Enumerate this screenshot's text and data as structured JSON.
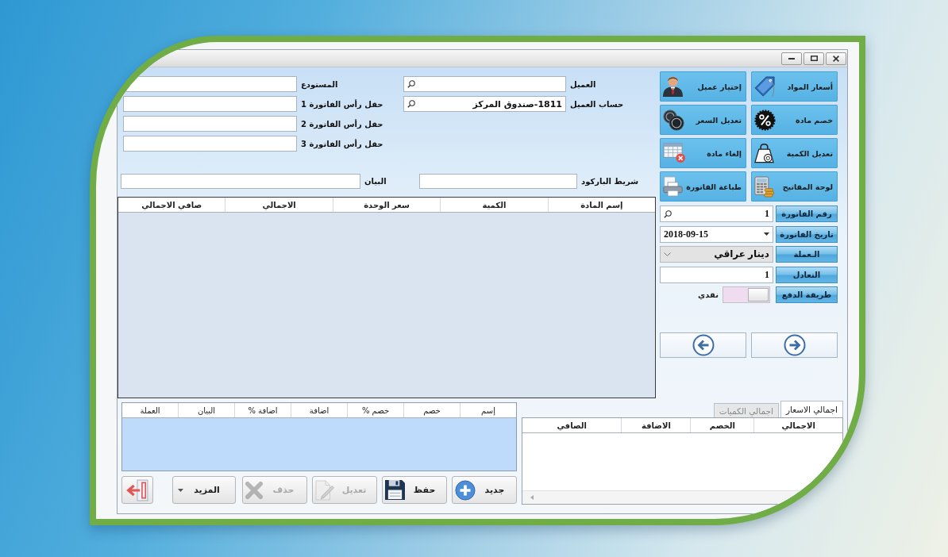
{
  "actions": [
    {
      "label": "أسعار المواد"
    },
    {
      "label": "إختيار عميل"
    },
    {
      "label": "خصم مادة"
    },
    {
      "label": "تعديل السعر"
    },
    {
      "label": "تعديل الكمية"
    },
    {
      "label": "إلغاء مادة"
    },
    {
      "label": "لوحة المفاتيح"
    },
    {
      "label": "طباعة الفاتورة"
    }
  ],
  "invoice_fields": [
    {
      "kind": "search",
      "label": "رقم الفاتورة",
      "value": "1"
    },
    {
      "kind": "date",
      "label": "تاريخ الفاتورة",
      "value": "2018-09-15"
    },
    {
      "kind": "combo",
      "label": "الـعملة",
      "value": "دينار عراقي"
    },
    {
      "kind": "text",
      "label": "التعادل",
      "value": "1"
    },
    {
      "kind": "toggle",
      "label": "طريقة الدفع",
      "on": false,
      "value": "نقدي"
    }
  ],
  "header_form": {
    "customer": [
      {
        "kind": "search",
        "label": "العميل"
      },
      {
        "kind": "search",
        "label": "حساب العميل",
        "value": "1811-صندوق المركز"
      }
    ],
    "invoice_header": [
      {
        "kind": "text",
        "label": "المستودع"
      },
      {
        "kind": "text",
        "label": "حقل رأس الفاتورة 1"
      },
      {
        "kind": "text",
        "label": "حقل رأس الفاتورة 2"
      },
      {
        "kind": "text",
        "label": "حقل رأس الفاتورة 3"
      }
    ]
  },
  "entry_row": [
    {
      "kind": "text",
      "label": "شريط الباركود"
    },
    {
      "kind": "text",
      "label": "البيان"
    }
  ],
  "items_table": {
    "columns": [
      "إسم المادة",
      "الكمية",
      "سعر الوحدة",
      "الاجمالي",
      "صافي الاجمالي"
    ]
  },
  "charges_table": {
    "columns": [
      "إسم",
      "خصم",
      "خصم %",
      "اضافة",
      "اضافة %",
      "البيان",
      "العملة"
    ]
  },
  "buttons": [
    {
      "kind": "button",
      "label": "جديد",
      "disabled": false
    },
    {
      "kind": "button",
      "label": "حفظ",
      "disabled": false
    },
    {
      "kind": "button",
      "label": "تعديل",
      "disabled": true
    },
    {
      "kind": "button",
      "label": "حذف",
      "disabled": true
    },
    {
      "kind": "menu",
      "label": "المزيد",
      "disabled": false
    },
    {
      "kind": "icon",
      "disabled": false
    }
  ],
  "totals": {
    "tabs": [
      {
        "label": "اجمالي الاسعار",
        "selected": true
      },
      {
        "label": "اجمالي الكميات",
        "selected": false
      }
    ],
    "columns": [
      "الاجمالي",
      "الخصم",
      "الاضافة",
      "الصافي"
    ]
  }
}
